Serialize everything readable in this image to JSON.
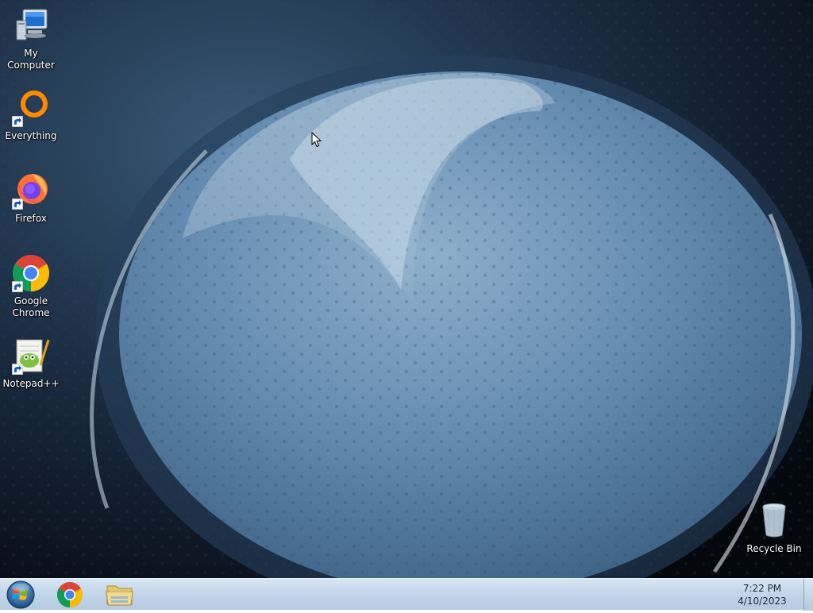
{
  "desktop": {
    "icons": [
      {
        "label": "My Computer",
        "icon": "computer-icon",
        "shortcut": false
      },
      {
        "label": "Everything",
        "icon": "everything-icon",
        "shortcut": true
      },
      {
        "label": "Firefox",
        "icon": "firefox-icon",
        "shortcut": true
      },
      {
        "label": "Google\nChrome",
        "icon": "chrome-icon",
        "shortcut": true
      },
      {
        "label": "Notepad++",
        "icon": "notepadpp-icon",
        "shortcut": true
      },
      {
        "label": "Recycle Bin",
        "icon": "recycle-bin-icon",
        "shortcut": false
      }
    ]
  },
  "taskbar": {
    "start_icon": "windows-logo-icon",
    "pinned": [
      {
        "name": "Google Chrome",
        "icon": "chrome-icon"
      },
      {
        "name": "Windows Explorer",
        "icon": "folder-icon"
      }
    ],
    "clock": {
      "time": "7:22 PM",
      "date": "4/10/2023"
    }
  },
  "colors": {
    "taskbar": "#c3d6ea",
    "wallpaper_blue": "#5f88ad",
    "wallpaper_dark": "#05080d"
  }
}
